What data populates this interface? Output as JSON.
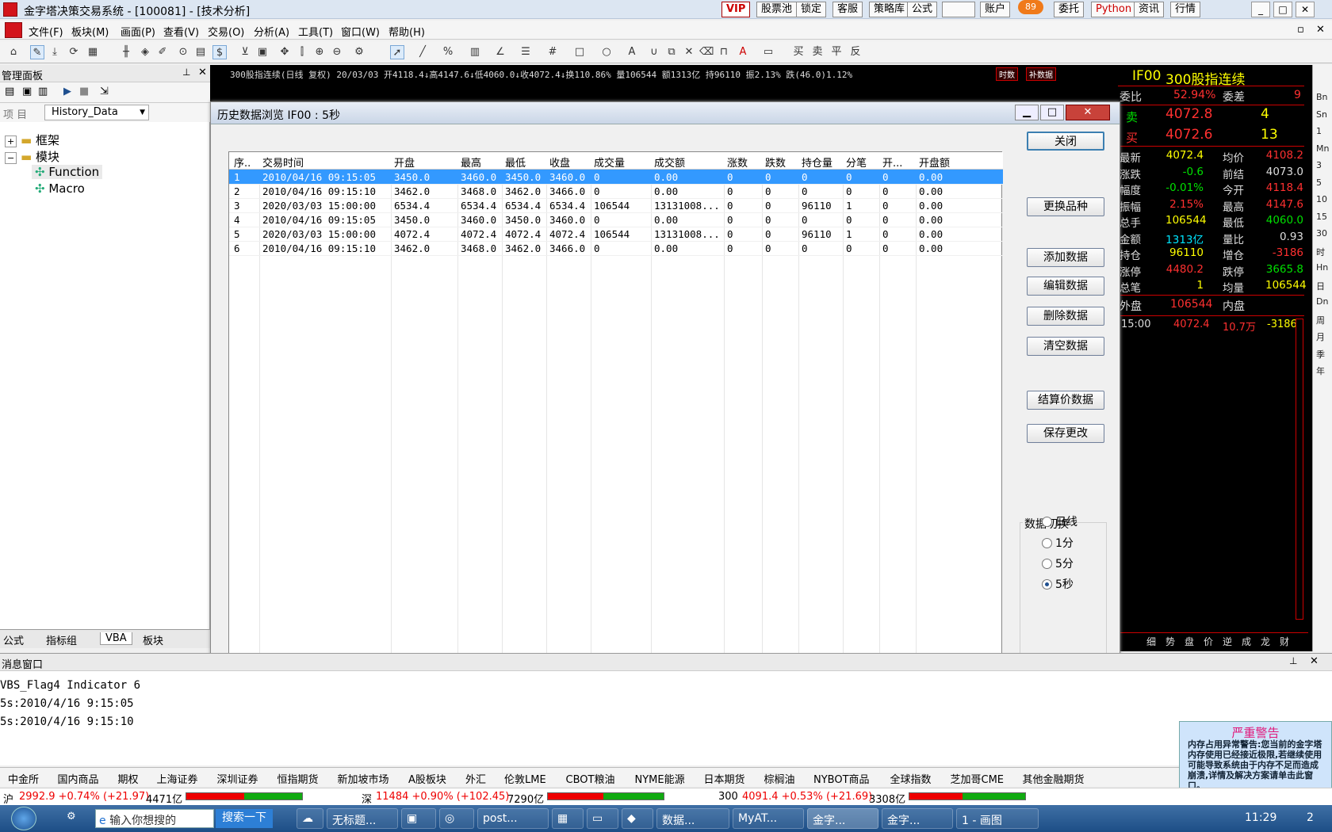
{
  "window": {
    "title": "金字塔决策交易系统 - [100081] - [技术分析]",
    "top_buttons": [
      "VIP",
      "股票池",
      "锁定",
      "客服",
      "策略库",
      "公式",
      "",
      "账户",
      "委托",
      "Python",
      "资讯",
      "行情"
    ],
    "badge": "89"
  },
  "menubar": {
    "items": [
      "文件(F)",
      "板块(M)",
      "画面(P)",
      "查看(V)",
      "交易(O)",
      "分析(A)",
      "工具(T)",
      "窗口(W)",
      "帮助(H)"
    ]
  },
  "manager": {
    "title": "管理面板",
    "selector_label": "项 目",
    "selector_value": "History_Data",
    "tree": {
      "frame": "框架",
      "module": "模块",
      "function": "Function",
      "macro": "Macro"
    },
    "bottom_tabs": [
      "公式",
      "指标组",
      "VBA",
      "板块"
    ]
  },
  "quote_line": {
    "text": "300股指连续(日线 复权) 20/03/03 开4118.4↓高4147.6↓低4060.0↓收4072.4↓换110.86% 量106544 额1313亿 持96110 振2.13% 跌(46.0)1.12%",
    "tags": [
      "时数",
      "补数据"
    ]
  },
  "right_panel": {
    "code": "IF00",
    "name": "300股指连续",
    "wei_bi_label": "委比",
    "wei_bi": "52.94%",
    "wei_cha_label": "委差",
    "wei_cha": "9",
    "sell_label": "卖",
    "sell_price": "4072.8",
    "sell_vol": "4",
    "buy_label": "买",
    "buy_price": "4072.6",
    "buy_vol": "13",
    "stats": [
      [
        "最新",
        "4072.4",
        "均价",
        "4108.2"
      ],
      [
        "涨跌",
        "-0.6",
        "前结",
        "4073.0"
      ],
      [
        "幅度",
        "-0.01%",
        "今开",
        "4118.4"
      ],
      [
        "振幅",
        "2.15%",
        "最高",
        "4147.6"
      ],
      [
        "总手",
        "106544",
        "最低",
        "4060.0"
      ],
      [
        "金额",
        "1313亿",
        "量比",
        "0.93"
      ],
      [
        "持仓",
        "96110",
        "增仓",
        "-3186"
      ],
      [
        "涨停",
        "4480.2",
        "跌停",
        "3665.8"
      ],
      [
        "总笔",
        "1",
        "均量",
        "106544"
      ]
    ],
    "wai_pan_label": "外盘",
    "wai_pan": "106544",
    "nei_pan_label": "内盘",
    "tick": {
      "time": "15:00",
      "price": "4072.4",
      "vol": "10.7万",
      "chg": "-3186"
    },
    "bottom_tabs": [
      "细",
      "势",
      "盘",
      "价",
      "逆",
      "成",
      "龙",
      "财"
    ]
  },
  "right_strip": [
    "Bn",
    "Sn",
    "1",
    "Mn",
    "3",
    "5",
    "10",
    "15",
    "30",
    "时",
    "Hn",
    "日",
    "Dn",
    "周",
    "月",
    "季",
    "年"
  ],
  "dialog": {
    "title": "历史数据浏览 IF00 : 5秒",
    "columns": [
      "序..",
      "交易时间",
      "开盘",
      "最高",
      "最低",
      "收盘",
      "成交量",
      "成交额",
      "涨数",
      "跌数",
      "持仓量",
      "分笔",
      "开...",
      "开盘额"
    ],
    "rows": [
      [
        "1",
        "2010/04/16 09:15:05",
        "3450.0",
        "3460.0",
        "3450.0",
        "3460.0",
        "0",
        "0.00",
        "0",
        "0",
        "0",
        "0",
        "0",
        "0.00"
      ],
      [
        "2",
        "2010/04/16 09:15:10",
        "3462.0",
        "3468.0",
        "3462.0",
        "3466.0",
        "0",
        "0.00",
        "0",
        "0",
        "0",
        "0",
        "0",
        "0.00"
      ],
      [
        "3",
        "2020/03/03 15:00:00",
        "6534.4",
        "6534.4",
        "6534.4",
        "6534.4",
        "106544",
        "13131008...",
        "0",
        "0",
        "96110",
        "1",
        "0",
        "0.00"
      ],
      [
        "4",
        "2010/04/16 09:15:05",
        "3450.0",
        "3460.0",
        "3450.0",
        "3460.0",
        "0",
        "0.00",
        "0",
        "0",
        "0",
        "0",
        "0",
        "0.00"
      ],
      [
        "5",
        "2020/03/03 15:00:00",
        "4072.4",
        "4072.4",
        "4072.4",
        "4072.4",
        "106544",
        "13131008...",
        "0",
        "0",
        "96110",
        "1",
        "0",
        "0.00"
      ],
      [
        "6",
        "2010/04/16 09:15:10",
        "3462.0",
        "3468.0",
        "3462.0",
        "3466.0",
        "0",
        "0.00",
        "0",
        "0",
        "0",
        "0",
        "0",
        "0.00"
      ]
    ],
    "buttons": {
      "close": "关闭",
      "change": "更换品种",
      "add": "添加数据",
      "edit": "编辑数据",
      "delete": "删除数据",
      "clear": "清空数据",
      "settle": "结算价数据",
      "save": "保存更改"
    },
    "switch_group": {
      "title": "数据切换",
      "options": [
        "日线",
        "1分",
        "5分",
        "5秒"
      ],
      "selected": "5秒"
    }
  },
  "message_window": {
    "title": "消息窗口",
    "lines": [
      "VBS_Flag4 Indicator 6",
      "5s:2010/4/16 9:15:05",
      "5s:2010/4/16 9:15:10"
    ]
  },
  "warning": {
    "title": "严重警告",
    "text": "内存占用异常警告:您当前的金字塔内存使用已经接近极限,若继续使用可能导致系统由于内存不足而造成崩溃,详情及解决方案请单击此窗口。"
  },
  "market_tabs": [
    "中金所",
    "国内商品",
    "期权",
    "上海证券",
    "深圳证券",
    "恒指期货",
    "新加坡市场",
    "A股板块",
    "外汇",
    "伦敦LME",
    "CBOT粮油",
    "NYME能源",
    "日本期货",
    "棕榈油",
    "NYBOT商品",
    "全球指数",
    "芝加哥CME",
    "其他金融期货"
  ],
  "index_bar": [
    {
      "label": "沪",
      "text": "2992.9 +0.74% (+21.97)",
      "amount": "4471亿"
    },
    {
      "label": "深",
      "text": "11484 +0.90% (+102.45)",
      "amount": "7290亿"
    },
    {
      "label": "300",
      "text": "4091.4 +0.53% (+21.69)",
      "amount": "3308亿"
    }
  ],
  "taskbar": {
    "search_placeholder": "输入你想搜的",
    "search_button": "搜索一下",
    "items": [
      "无标题...",
      "post...",
      "数据...",
      "MyAT...",
      "金字...",
      "金字...",
      "1 - 画图"
    ],
    "clock": "11:29",
    "desktop_num": "2"
  },
  "colors": {
    "up": "#ff3030",
    "down": "#00e000",
    "accent": "#ffff00"
  }
}
